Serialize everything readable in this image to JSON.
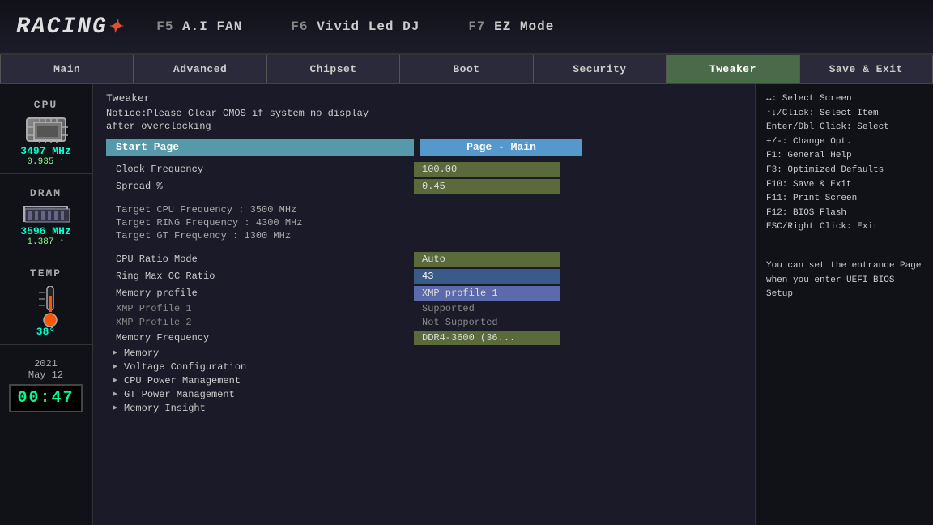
{
  "topbar": {
    "logo": "RACING",
    "logo_symbol": "✦",
    "nav_items": [
      {
        "key": "F5",
        "label": "A.I FAN"
      },
      {
        "key": "F6",
        "label": "Vivid Led DJ"
      },
      {
        "key": "F7",
        "label": "EZ Mode"
      }
    ]
  },
  "menu_tabs": [
    {
      "id": "main",
      "label": "Main",
      "active": false
    },
    {
      "id": "advanced",
      "label": "Advanced",
      "active": false
    },
    {
      "id": "chipset",
      "label": "Chipset",
      "active": false
    },
    {
      "id": "boot",
      "label": "Boot",
      "active": false
    },
    {
      "id": "security",
      "label": "Security",
      "active": false
    },
    {
      "id": "tweaker",
      "label": "Tweaker",
      "active": true
    },
    {
      "id": "save-exit",
      "label": "Save & Exit",
      "active": false
    }
  ],
  "sidebar": {
    "cpu_label": "CPU",
    "cpu_freq": "3497 MHz",
    "cpu_volt": "0.935 ↑",
    "dram_label": "DRAM",
    "dram_freq": "3596 MHz",
    "dram_volt": "1.387 ↑",
    "temp_label": "TEMP",
    "temp_value": "38°",
    "date_year": "2021",
    "date_month_day": "May  12",
    "time": "00:47"
  },
  "content": {
    "section_title": "Tweaker",
    "notice_line1": "Notice:Please Clear CMOS if system no display",
    "notice_line2": "after overclocking",
    "start_page_label": "Start Page",
    "start_page_value": "Page - Main",
    "clock_frequency_label": "Clock Frequency",
    "clock_frequency_value": "100.00",
    "spread_label": "Spread %",
    "spread_value": "0.45",
    "target_cpu": "Target CPU Frequency : 3500 MHz",
    "target_ring": "Target RING Frequency : 4300 MHz",
    "target_gt": "Target GT Frequency : 1300 MHz",
    "cpu_ratio_label": "CPU Ratio Mode",
    "cpu_ratio_value": "Auto",
    "ring_max_label": "Ring Max OC Ratio",
    "ring_max_value": "43",
    "memory_profile_label": "Memory profile",
    "memory_profile_value": "XMP profile 1",
    "xmp1_label": "XMP Profile 1",
    "xmp1_value": "Supported",
    "xmp2_label": "XMP Profile 2",
    "xmp2_value": "Not Supported",
    "mem_freq_label": "Memory Frequency",
    "mem_freq_value": "DDR4-3600  (36...",
    "expandable": [
      {
        "label": "Memory"
      },
      {
        "label": "Voltage Configuration"
      },
      {
        "label": "CPU Power Management"
      },
      {
        "label": "GT Power Management"
      },
      {
        "label": "Memory Insight"
      }
    ]
  },
  "help": {
    "shortcuts": "↔: Select Screen\n↑↓/Click: Select Item\nEnter/Dbl Click: Select\n+/-: Change Opt.\nF1: General Help\nF3: Optimized Defaults\nF10: Save & Exit\nF11: Print Screen\nF12: BIOS Flash\nESC/Right Click: Exit",
    "description": "You can set the\nentrance Page when\nyou enter UEFI BIOS\nSetup"
  }
}
